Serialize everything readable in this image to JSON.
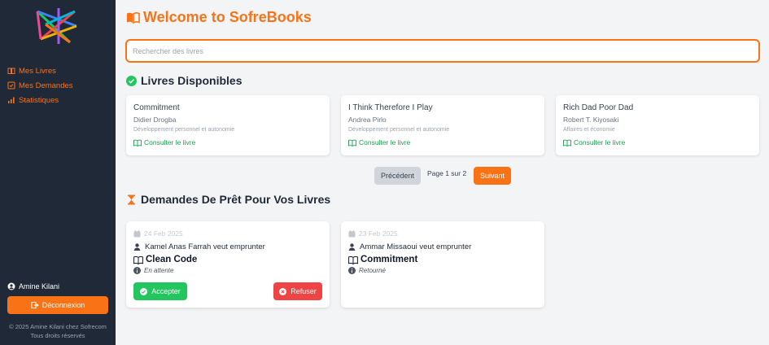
{
  "sidebar": {
    "nav": [
      {
        "label": "Mes Livres",
        "icon": "book-icon"
      },
      {
        "label": "Mes Demandes",
        "icon": "checkbox-icon"
      },
      {
        "label": "Statistiques",
        "icon": "bar-chart-icon"
      }
    ],
    "user_name": "Amine Kilani",
    "logout_label": "Déconnexion",
    "copyright_line1": "© 2025 Amine Kilani chez Sofrecom",
    "copyright_line2": "Tous droits réservés"
  },
  "header": {
    "title": "Welcome to SofreBooks"
  },
  "search": {
    "placeholder": "Rechercher des livres",
    "value": ""
  },
  "available": {
    "title": "Livres Disponibles",
    "books": [
      {
        "title": "Commitment",
        "author": "Didier Drogba",
        "category": "Développement personnel et autonomie",
        "link": "Consulter le livre"
      },
      {
        "title": "I Think Therefore I Play",
        "author": "Andrea Pirlo",
        "category": "Développement personnel et autonomie",
        "link": "Consulter le livre"
      },
      {
        "title": "Rich Dad Poor Dad",
        "author": "Robert T. Kiyosaki",
        "category": "Affaires et économie",
        "link": "Consulter le livre"
      }
    ]
  },
  "pagination": {
    "prev_label": "Précédent",
    "page_info": "Page 1 sur 2",
    "next_label": "Suivant"
  },
  "requests": {
    "title": "Demandes De Prêt Pour Vos Livres",
    "items": [
      {
        "date": "24 Feb 2025",
        "who": "Kamel Anas Farrah veut emprunter",
        "book": "Clean Code",
        "status": "En attente",
        "accept_label": "Accepter",
        "refuse_label": "Refuser"
      },
      {
        "date": "23 Feb 2025",
        "who": "Ammar Missaoui veut emprunter",
        "book": "Commitment",
        "status": "Retourné"
      }
    ]
  },
  "colors": {
    "accent": "#f97316",
    "sidebar_bg": "#1f2937",
    "success": "#22c55e",
    "danger": "#ef4444",
    "link": "#16a34a"
  }
}
